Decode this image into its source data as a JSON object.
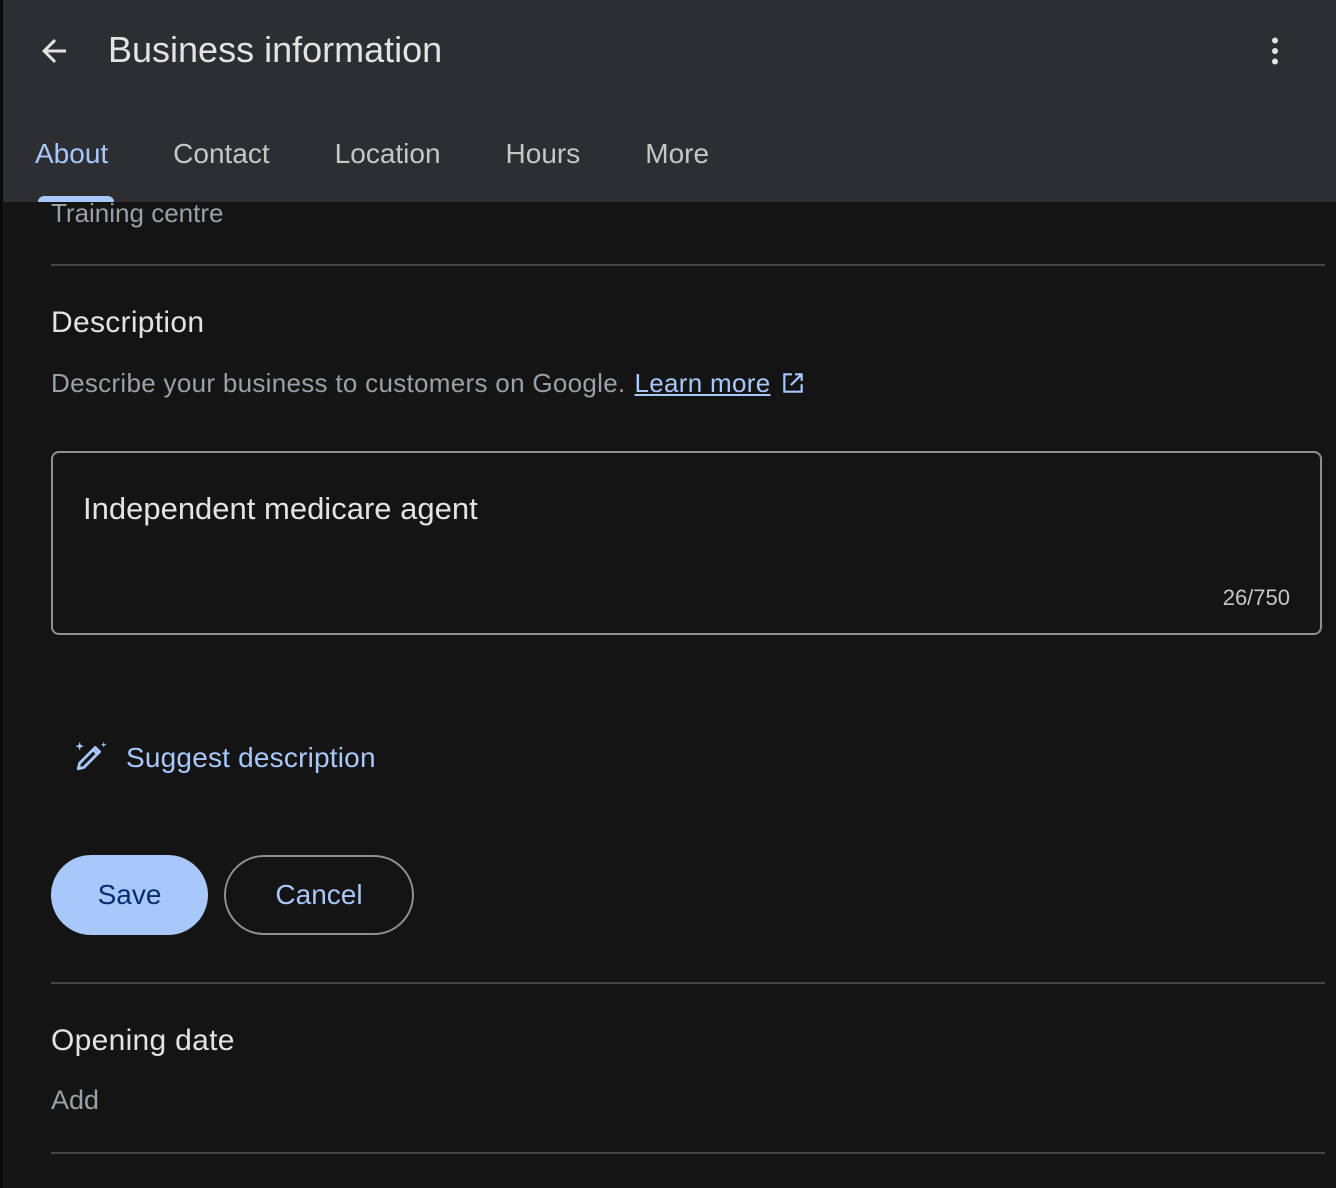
{
  "header": {
    "title": "Business information",
    "back_icon": "arrow-back-icon",
    "menu_icon": "more-vert-icon"
  },
  "tabs": [
    {
      "label": "About",
      "active": true
    },
    {
      "label": "Contact",
      "active": false
    },
    {
      "label": "Location",
      "active": false
    },
    {
      "label": "Hours",
      "active": false
    },
    {
      "label": "More",
      "active": false
    }
  ],
  "category": {
    "value": "Training centre"
  },
  "description": {
    "title": "Description",
    "help_text": "Describe your business to customers on Google.",
    "learn_more_label": "Learn more",
    "value": "Independent medicare agent",
    "char_count": "26/750",
    "suggest_label": "Suggest description",
    "save_label": "Save",
    "cancel_label": "Cancel"
  },
  "opening_date": {
    "title": "Opening date",
    "add_label": "Add"
  },
  "colors": {
    "header_bg": "#2d2e31",
    "page_bg": "#141414",
    "accent": "#a8c7fa",
    "primary_button_text": "#062e6f",
    "secondary_text": "#9aa0a6",
    "divider": "#444746"
  }
}
